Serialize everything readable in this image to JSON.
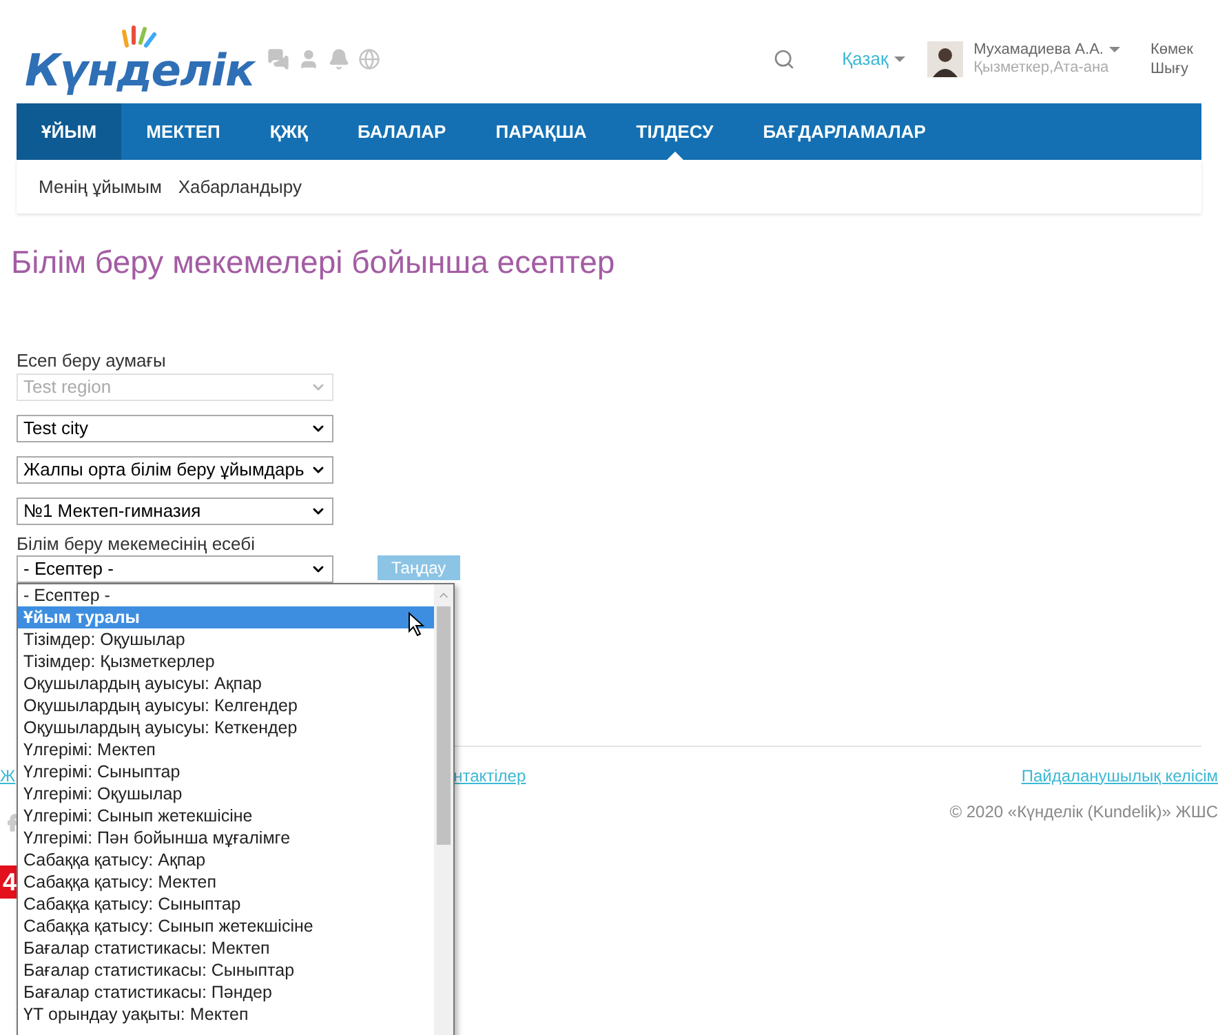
{
  "header": {
    "logo": "Күнделік",
    "language": "Қазақ",
    "user": {
      "name": "Мухамадиева А.А.",
      "role": "Қызметкер,Ата-ана"
    },
    "links": [
      "Көмек",
      "Шығу"
    ]
  },
  "nav": [
    {
      "label": "ҰЙЫМ",
      "selected": true,
      "notched": false
    },
    {
      "label": "МЕКТЕП",
      "selected": false,
      "notched": false
    },
    {
      "label": "ҚЖҚ",
      "selected": false,
      "notched": false
    },
    {
      "label": "БАЛАЛАР",
      "selected": false,
      "notched": false
    },
    {
      "label": "ПАРАҚША",
      "selected": false,
      "notched": false
    },
    {
      "label": "ТІЛДЕСУ",
      "selected": false,
      "notched": true
    },
    {
      "label": "БАҒДАРЛАМАЛАР",
      "selected": false,
      "notched": false
    }
  ],
  "subnav": [
    "Менің ұйымым",
    "Хабарландыру"
  ],
  "title": "Білім беру мекемелері бойынша есептер",
  "form": {
    "region_label": "Есеп беру аумағы",
    "selects": [
      {
        "value": "Test region",
        "disabled": true
      },
      {
        "value": "Test city",
        "disabled": false
      },
      {
        "value": "Жалпы орта білім беру ұйымдарь",
        "disabled": false
      },
      {
        "value": "№1 Мектеп-гимназия",
        "disabled": false
      }
    ],
    "report_label": "Білім беру мекемесінің есебі",
    "report_select": {
      "value": "- Есептер -",
      "expanded": true
    },
    "button": "Таңдау",
    "options": [
      {
        "label": "- Есептер -",
        "selected": false
      },
      {
        "label": "Ұйым туралы",
        "selected": true
      },
      {
        "label": "Тізімдер: Оқушылар",
        "selected": false
      },
      {
        "label": "Тізімдер: Қызметкерлер",
        "selected": false
      },
      {
        "label": "Оқушылардың ауысуы: Ақпар",
        "selected": false
      },
      {
        "label": "Оқушылардың ауысуы: Келгендер",
        "selected": false
      },
      {
        "label": "Оқушылардың ауысуы: Кеткендер",
        "selected": false
      },
      {
        "label": "Үлгерімі: Мектеп",
        "selected": false
      },
      {
        "label": "Үлгерімі: Сыныптар",
        "selected": false
      },
      {
        "label": "Үлгерімі: Оқушылар",
        "selected": false
      },
      {
        "label": "Үлгерімі: Сынып жетекшісіне",
        "selected": false
      },
      {
        "label": "Үлгерімі: Пән бойынша мұғалімге",
        "selected": false
      },
      {
        "label": "Сабаққа қатысу: Ақпар",
        "selected": false
      },
      {
        "label": "Сабаққа қатысу: Мектеп",
        "selected": false
      },
      {
        "label": "Сабаққа қатысу: Сыныптар",
        "selected": false
      },
      {
        "label": "Сабаққа қатысу: Сынып жетекшісіне",
        "selected": false
      },
      {
        "label": "Бағалар статистикасы: Мектеп",
        "selected": false
      },
      {
        "label": "Бағалар статистикасы: Сыныптар",
        "selected": false
      },
      {
        "label": "Бағалар статистикасы: Пәндер",
        "selected": false
      },
      {
        "label": "ҮТ орындау уақыты: Мектеп",
        "selected": false
      }
    ]
  },
  "footer": {
    "left_links": [
      "Ж",
      "нтактілер"
    ],
    "agreement": "Пайдаланушылық келісім",
    "copyright": "© 2020 «Күнделік (Kundelik)» ЖШС",
    "badge": "4"
  }
}
